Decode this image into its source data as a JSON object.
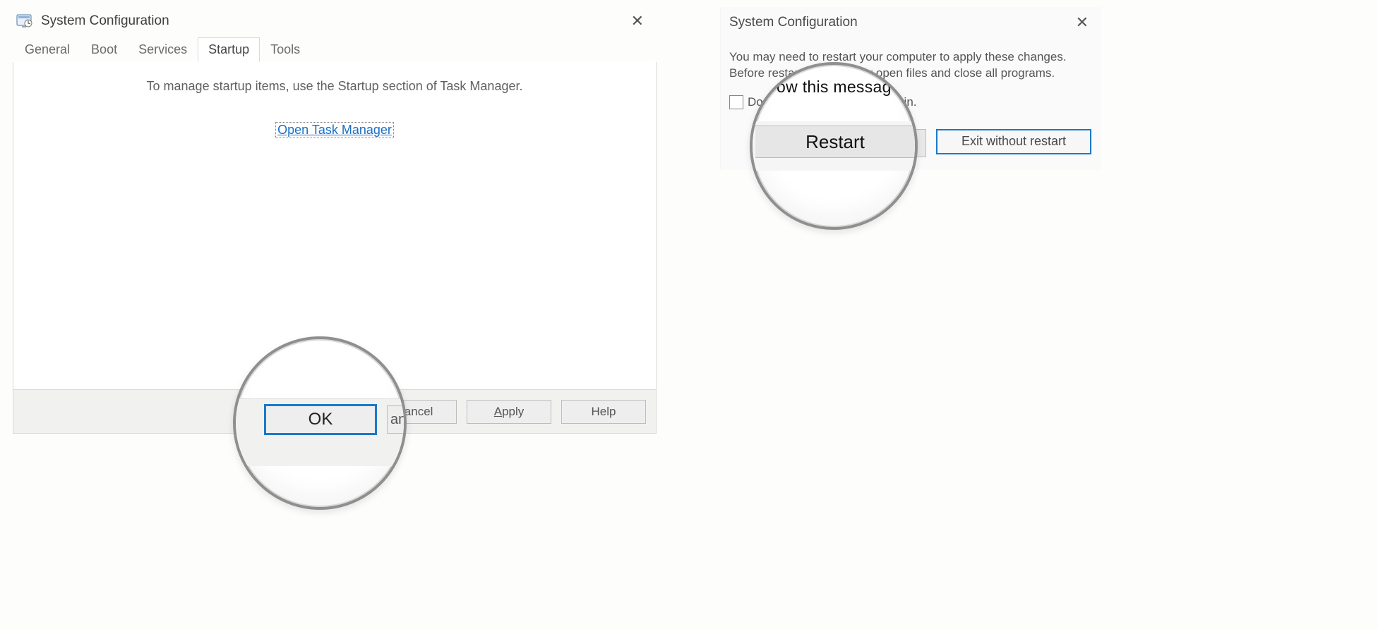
{
  "msconfig": {
    "title": "System Configuration",
    "tabs": {
      "general": "General",
      "boot": "Boot",
      "services": "Services",
      "startup": "Startup",
      "tools": "Tools"
    },
    "startup_msg": "To manage startup items, use the Startup section of Task Manager.",
    "open_tm_link": "Open Task Manager",
    "buttons": {
      "ok": "OK",
      "cancel": "Cancel",
      "apply_pre": "A",
      "apply_post": "pply",
      "help": "Help"
    }
  },
  "restart": {
    "title": "System Configuration",
    "line1": "You may need to restart your computer to apply these changes.",
    "line2": "Before restarting, save any open files and close all programs.",
    "checkbox_label_pre": "D",
    "checkbox_label_mid": "on't show this message again",
    "checkbox_label_post": ".",
    "restart_btn": "Restart",
    "exit_btn": "Exit without restart"
  },
  "lens": {
    "ok": "OK",
    "cancel_frag": "ancel",
    "restart": "Restart",
    "hint": "ow this messag"
  }
}
